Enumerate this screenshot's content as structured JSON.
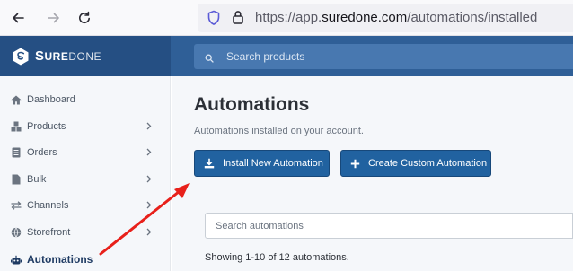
{
  "browser": {
    "url_prefix": "https://app.",
    "url_domain": "suredone.com",
    "url_path": "/automations/installed",
    "icons": {
      "back": "back-arrow-icon",
      "forward": "forward-arrow-icon",
      "reload": "reload-icon",
      "shield": "shield-icon",
      "lock": "lock-icon"
    }
  },
  "header": {
    "logo_s": "S",
    "logo_rest": "URE",
    "logo_done": "DONE",
    "search_placeholder": "Search products"
  },
  "sidebar": {
    "items": [
      {
        "label": "Dashboard",
        "icon": "home-icon",
        "has_chevron": false
      },
      {
        "label": "Products",
        "icon": "cubes-icon",
        "has_chevron": true
      },
      {
        "label": "Orders",
        "icon": "list-icon",
        "has_chevron": true
      },
      {
        "label": "Bulk",
        "icon": "file-icon",
        "has_chevron": true
      },
      {
        "label": "Channels",
        "icon": "exchange-icon",
        "has_chevron": true
      },
      {
        "label": "Storefront",
        "icon": "globe-icon",
        "has_chevron": true
      },
      {
        "label": "Automations",
        "icon": "robot-icon",
        "has_chevron": false,
        "active": true
      }
    ]
  },
  "main": {
    "title": "Automations",
    "subtitle": "Automations installed on your account.",
    "install_button": "Install New Automation",
    "create_button": "Create Custom Automation",
    "search_placeholder": "Search automations",
    "showing_text": "Showing 1-10 of 12 automations."
  },
  "colors": {
    "header": "#2f5f97",
    "logo_bg": "#254f83",
    "button": "#2162a0",
    "annotation": "#e8201a"
  }
}
